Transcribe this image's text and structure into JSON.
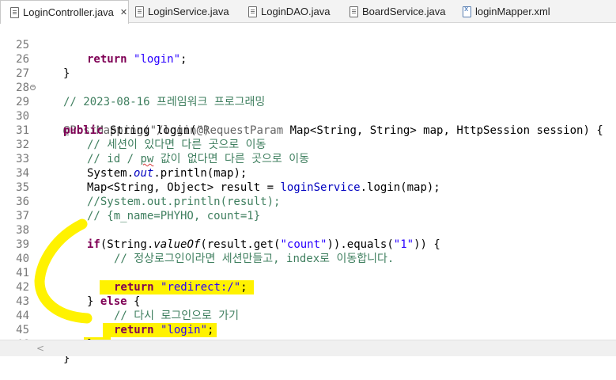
{
  "tabs": [
    {
      "label": "LoginController.java",
      "icon": "java-file-icon",
      "active": true,
      "close": "✕"
    },
    {
      "label": "LoginService.java",
      "icon": "java-file-icon",
      "active": false
    },
    {
      "label": "LoginDAO.java",
      "icon": "java-file-icon",
      "active": false
    },
    {
      "label": "BoardService.java",
      "icon": "java-file-icon",
      "active": false
    },
    {
      "label": "loginMapper.xml",
      "icon": "xml-file-icon",
      "active": false
    }
  ],
  "editor": {
    "lines": [
      {
        "n": "25"
      },
      {
        "n": "26"
      },
      {
        "n": "27"
      },
      {
        "n": "28"
      },
      {
        "n": "29"
      },
      {
        "n": "30"
      },
      {
        "n": "31"
      },
      {
        "n": "32"
      },
      {
        "n": "33"
      },
      {
        "n": "34"
      },
      {
        "n": "35"
      },
      {
        "n": "36"
      },
      {
        "n": "37"
      },
      {
        "n": "38"
      },
      {
        "n": "39"
      },
      {
        "n": "40"
      },
      {
        "n": "41"
      },
      {
        "n": "42"
      },
      {
        "n": "43"
      },
      {
        "n": "44"
      },
      {
        "n": "45"
      },
      {
        "n": "46"
      }
    ],
    "tokens": {
      "l25_kw": "return",
      "l25_str": "\"login\"",
      "l25_end": ";",
      "l26": "}",
      "l28_cmt": "// 2023-08-16 프레임워크 프로그래밍",
      "l29_ann": "@PostMapping(\"/login\")",
      "l30_kw1": "public",
      "l30_a": " String login(",
      "l30_ann": "@RequestParam",
      "l30_b": " Map<String, String> map, HttpSession session) {",
      "l31_cmt": "// 세션이 있다면 다른 곳으로 이동",
      "l32_cmt_a": "// id / ",
      "l32_cmt_pw": "pw",
      "l32_cmt_b": " 값이 없다면 다른 곳으로 이동",
      "l33_a": "System.",
      "l33_out": "out",
      "l33_b": ".println(map);",
      "l34_a": "Map<String, Object> result = ",
      "l34_fld": "loginService",
      "l34_b": ".login(map);",
      "l35_cmt": "//System.out.println(result);",
      "l36_cmt": "// {m_name=PHYHO, count=1}",
      "l38_kw": "if",
      "l38_a": "(String.",
      "l38_valueof": "valueOf",
      "l38_b": "(result.get(",
      "l38_str1": "\"count\"",
      "l38_c": ")).equals(",
      "l38_str2": "\"1\"",
      "l38_d": ")) {",
      "l39_cmt": "// 정상로그인이라면 세션만들고, index로 이동합니다.",
      "l41_kw": "return",
      "l41_str": "\"redirect:/\"",
      "l41_end": ";",
      "l42_a": "} ",
      "l42_kw": "else",
      "l42_b": " {",
      "l43_cmt": "// 다시 로그인으로 가기",
      "l44_kw": "return",
      "l44_str": "\"login\"",
      "l44_end": ";",
      "l45": "}",
      "l46": "}"
    },
    "fold_marker": "−"
  },
  "colors": {
    "keyword": "#7f0055",
    "string": "#2a00ff",
    "comment": "#3f7f5f",
    "annotation": "#646464",
    "field": "#0000c0",
    "highlight": "#fff200"
  },
  "scrollbar": {
    "left_arrow": "<"
  }
}
